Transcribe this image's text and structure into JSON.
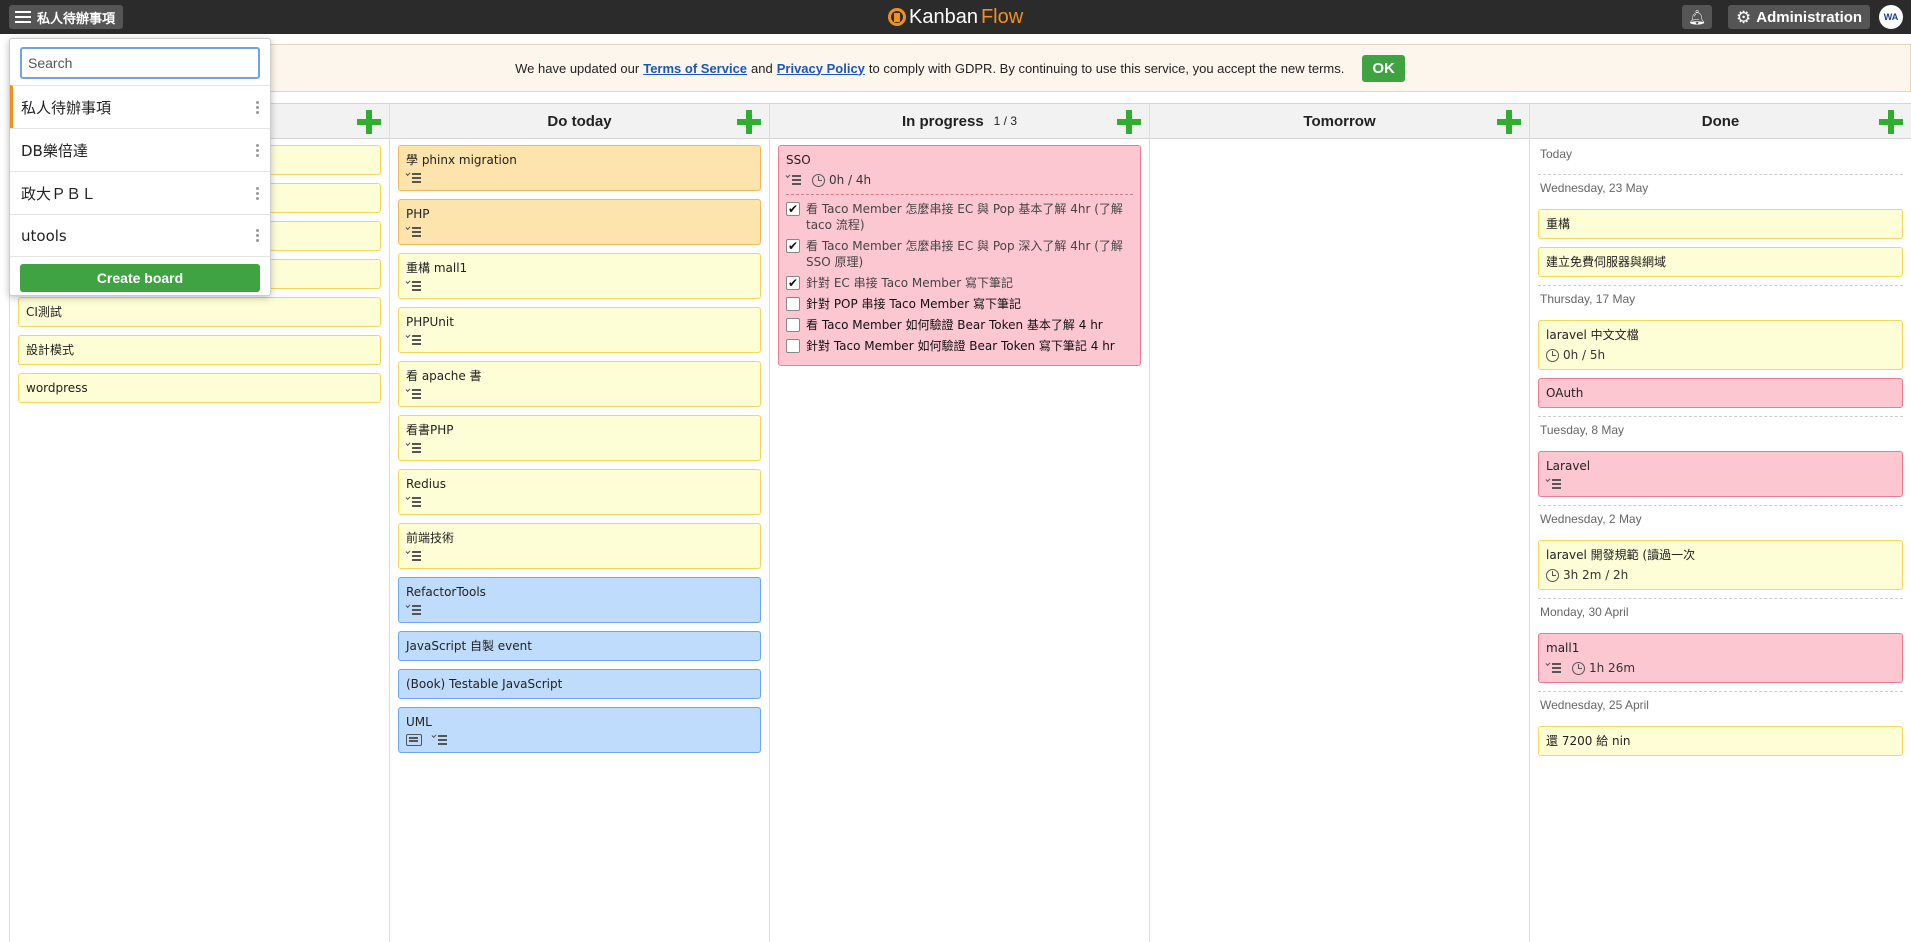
{
  "topbar": {
    "board_name": "私人待辦事項",
    "logo_kanban": "Kanban",
    "logo_flow": "Flow",
    "admin_label": "Administration",
    "avatar_initials": "WA"
  },
  "gdpr": {
    "text_before": "We have updated our",
    "terms_link": "Terms of Service",
    "and": "and",
    "privacy_link": "Privacy Policy",
    "text_after": "to comply with GDPR. By continuing to use this service, you accept the new terms.",
    "ok_label": "OK"
  },
  "dropdown": {
    "search_placeholder": "Search",
    "boards": [
      "私人待辦事項",
      "DB樂倍達",
      "政大ＰＢＬ",
      "utools"
    ],
    "create_label": "Create board"
  },
  "columns": {
    "todo": {
      "tasks": [
        "",
        "",
        "",
        "",
        "CI測試",
        "設計模式",
        "wordpress"
      ]
    },
    "do_today": {
      "title": "Do today",
      "tasks": [
        "學 phinx migration",
        "PHP",
        "重構 mall1",
        "PHPUnit",
        "看 apache 書",
        "看書PHP",
        "Redius",
        "前端技術",
        "RefactorTools",
        "JavaScript 自製 event",
        "(Book) Testable JavaScript",
        "UML"
      ]
    },
    "in_progress": {
      "title": "In progress",
      "wip": "1 / 3",
      "task_title": "SSO",
      "task_time": "0h / 4h",
      "subtasks": [
        "看 Taco Member 怎麼串接 EC 與 Pop 基本了解 4hr (了解 taco 流程)",
        "看 Taco Member 怎麼串接 EC 與 Pop 深入了解 4hr (了解 SSO 原理)",
        "針對 EC 串接 Taco Member 寫下筆記",
        "針對 POP 串接 Taco Member 寫下筆記",
        "看 Taco Member 如何驗證 Bear Token 基本了解 4 hr",
        "針對 Taco Member 如何驗證 Bear Token 寫下筆記 4 hr"
      ]
    },
    "tomorrow": {
      "title": "Tomorrow"
    },
    "done": {
      "title": "Done",
      "groups": [
        {
          "date": "Today"
        },
        {
          "date": "Wednesday, 23 May",
          "tasks": [
            "重構",
            "建立免費伺服器與網域"
          ]
        },
        {
          "date": "Thursday, 17 May",
          "tasks": [
            "laravel 中文文檔",
            "OAuth"
          ],
          "time": "0h / 5h"
        },
        {
          "date": "Tuesday, 8 May",
          "tasks": [
            "Laravel"
          ]
        },
        {
          "date": "Wednesday, 2 May",
          "tasks": [
            "laravel 開發規範 (讀過一次"
          ],
          "time": "3h 2m / 2h"
        },
        {
          "date": "Monday, 30 April",
          "tasks": [
            "mall1"
          ],
          "time": "1h 26m"
        },
        {
          "date": "Wednesday, 25 April",
          "tasks": [
            "還 7200 給 nin"
          ]
        }
      ]
    }
  }
}
